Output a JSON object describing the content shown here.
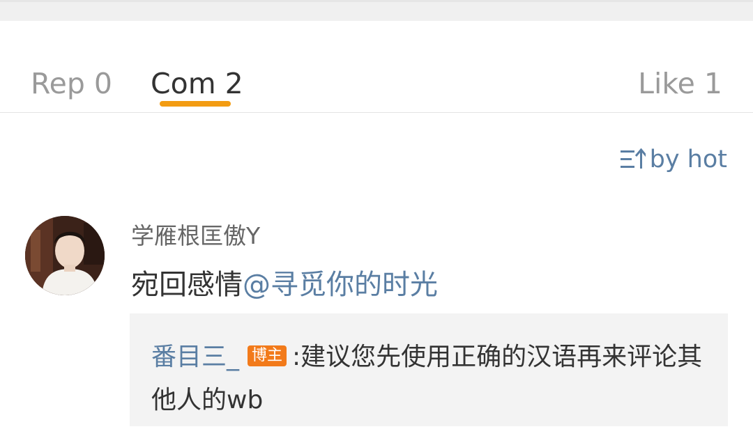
{
  "tabs": {
    "rep_label": "Rep 0",
    "com_label": "Com 2",
    "like_label": "Like 1",
    "active": "com"
  },
  "sort": {
    "label": "by hot",
    "icon": "sort-icon"
  },
  "comment": {
    "username": "学雁根匡傲Y",
    "text_plain": "宛回感情",
    "mention": "@寻觅你的时光",
    "avatar_icon": "avatar"
  },
  "reply": {
    "author": "番目三_",
    "badge": "博主",
    "separator": ":",
    "text": "建议您先使用正确的汉语再来评论其他人的wb"
  },
  "colors": {
    "accent": "#f39c12",
    "link": "#5a7ea3",
    "badge": "#f27a1a",
    "reply_bg": "#f3f3f3"
  }
}
